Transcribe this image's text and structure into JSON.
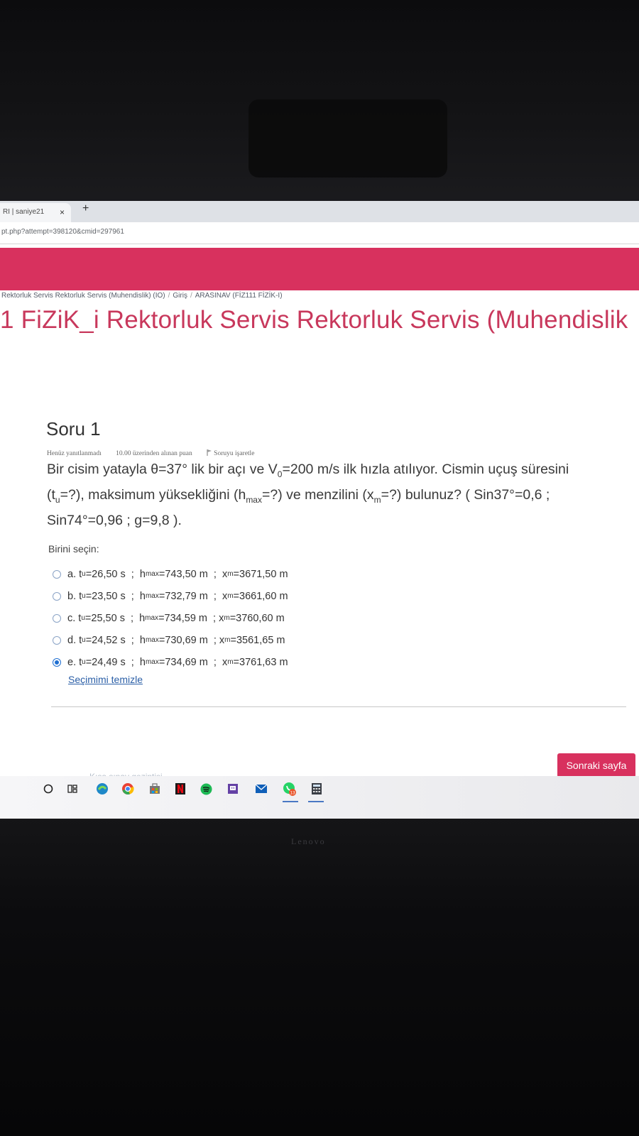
{
  "browser": {
    "tab_title": "RI | saniye21",
    "tab_close": "×",
    "new_tab": "+",
    "url": "pt.php?attempt=398120&cmid=297961"
  },
  "breadcrumb": {
    "items": [
      "Rektorluk Servis Rektorluk Servis (Muhendislik) (IO)",
      "Giriş",
      "ARASINAV (FİZ111 FİZİK-I)"
    ],
    "separator": "/"
  },
  "course_title": "1 FiZiK_i Rektorluk Servis Rektorluk Servis (Muhendislik",
  "question": {
    "heading": "Soru 1",
    "status": "Henüz yanıtlanmadı",
    "points": "10.00 üzerinden alınan puan",
    "flag_label": "Soruyu işaretle",
    "text_line1": "Bir cisim yatayla θ=37° lik bir açı ve V",
    "text_line1_sub": "0",
    "text_line1_end": "=200 m/s ilk hızla atılıyor. Cismin uçuş süresini",
    "text_line2_a": "(t",
    "text_line2_a_sub": "u",
    "text_line2_b": "=?), maksimum yüksekliğini (h",
    "text_line2_b_sub": "max",
    "text_line2_c": "=?) ve menzilini (x",
    "text_line2_c_sub": "m",
    "text_line2_d": "=?) bulunuz? ( Sin37°=0,6 ;",
    "text_line3": "Sin74°=0,96   ;   g=9,8 )."
  },
  "choose_label": "Birini seçin:",
  "options": [
    {
      "prefix": "a. t",
      "t_sub": "u",
      "t_val": "=26,50 s  ;  h",
      "h_sub": "max",
      "h_val": "=743,50 m  ;  x",
      "x_sub": "m",
      "x_val": "=3671,50 m",
      "selected": false
    },
    {
      "prefix": "b. t",
      "t_sub": "u",
      "t_val": "=23,50 s  ;  h",
      "h_sub": "max",
      "h_val": "=732,79 m  ;  x",
      "x_sub": "m",
      "x_val": "=3661,60 m",
      "selected": false
    },
    {
      "prefix": "c. t",
      "t_sub": "u",
      "t_val": "=25,50 s  ;  h",
      "h_sub": "max",
      "h_val": "=734,59 m  ; x",
      "x_sub": "m",
      "x_val": "=3760,60 m",
      "selected": false
    },
    {
      "prefix": "d. t",
      "t_sub": "u",
      "t_val": "=24,52 s  ;  h",
      "h_sub": "max",
      "h_val": "=730,69 m  ; x",
      "x_sub": "m",
      "x_val": "=3561,65 m",
      "selected": false
    },
    {
      "prefix": "e. t",
      "t_sub": "u",
      "t_val": "=24,49 s  ;  h",
      "h_sub": "max",
      "h_val": "=734,69 m  ;  x",
      "x_sub": "m",
      "x_val": "=3761,63 m",
      "selected": true
    }
  ],
  "clear_choice": "Seçimimi temizle",
  "next_button": "Sonraki sayfa",
  "summary_link": "Kısa sınav gezintisi",
  "taskbar": {
    "icons": [
      "start-icon",
      "task-view-icon",
      "edge-icon",
      "chrome-icon",
      "store-icon",
      "netflix-icon",
      "spotify-icon",
      "twitch-icon",
      "mail-icon",
      "whatsapp-icon",
      "calculator-icon"
    ],
    "whatsapp_badge": "13",
    "accent_color": "#4a78c4"
  },
  "brand": "Lenovo",
  "colors": {
    "accent": "#d8315e",
    "title": "#c8385c",
    "link": "#2b5fa7"
  }
}
